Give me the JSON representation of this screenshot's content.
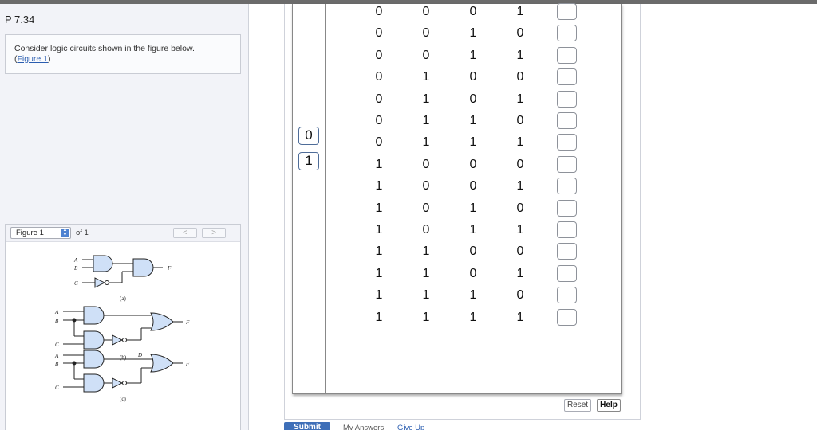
{
  "problem": {
    "title": "P 7.34",
    "text": "Consider logic circuits shown in the figure below.",
    "link_open": "(",
    "link_label": "Figure 1",
    "link_close": ")"
  },
  "figure": {
    "selected": "Figure 1",
    "of_text": "of 1",
    "prev": "<",
    "next": ">",
    "labels": {
      "a": "(a)",
      "b": "(b)",
      "c": "(c)",
      "A": "A",
      "B": "B",
      "C": "C",
      "D": "D",
      "F": "F"
    }
  },
  "palette": {
    "zero": "0",
    "one": "1"
  },
  "truth_table": {
    "rows": [
      [
        "0",
        "0",
        "0",
        "1"
      ],
      [
        "0",
        "0",
        "1",
        "0"
      ],
      [
        "0",
        "0",
        "1",
        "1"
      ],
      [
        "0",
        "1",
        "0",
        "0"
      ],
      [
        "0",
        "1",
        "0",
        "1"
      ],
      [
        "0",
        "1",
        "1",
        "0"
      ],
      [
        "0",
        "1",
        "1",
        "1"
      ],
      [
        "1",
        "0",
        "0",
        "0"
      ],
      [
        "1",
        "0",
        "0",
        "1"
      ],
      [
        "1",
        "0",
        "1",
        "0"
      ],
      [
        "1",
        "0",
        "1",
        "1"
      ],
      [
        "1",
        "1",
        "0",
        "0"
      ],
      [
        "1",
        "1",
        "0",
        "1"
      ],
      [
        "1",
        "1",
        "1",
        "0"
      ],
      [
        "1",
        "1",
        "1",
        "1"
      ]
    ]
  },
  "buttons": {
    "reset": "Reset",
    "help": "Help",
    "submit": "Submit",
    "my_answers": "My Answers",
    "give_up": "Give Up"
  },
  "colors": {
    "gate_fill": "#cfe0f7",
    "link": "#2a5db0",
    "submit": "#3e6fb8"
  }
}
